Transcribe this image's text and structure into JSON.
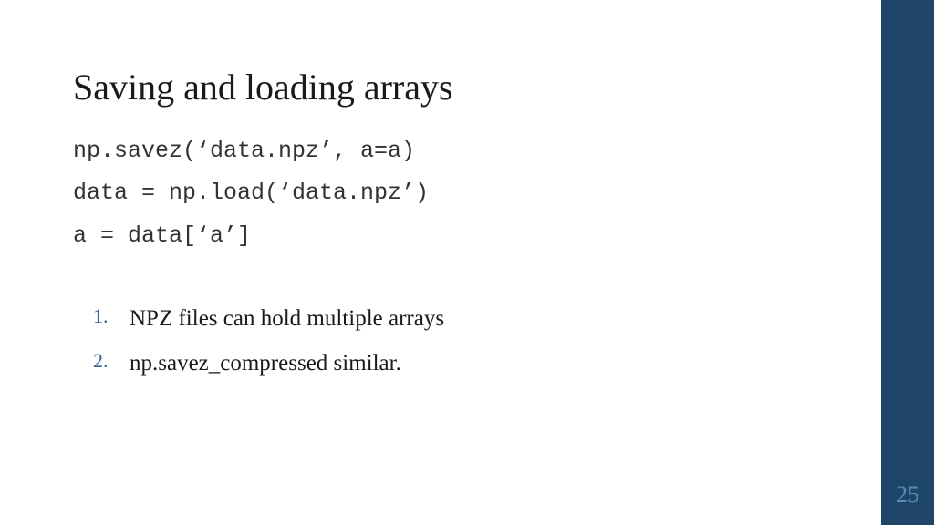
{
  "slide": {
    "title": "Saving and loading arrays",
    "code_lines": [
      "np.savez(‘data.npz’, a=a)",
      "data = np.load(‘data.npz’)",
      "a = data[‘a’]"
    ],
    "list_items": [
      "NPZ files can hold multiple arrays",
      "np.savez_compressed similar."
    ],
    "page_number": "25"
  }
}
